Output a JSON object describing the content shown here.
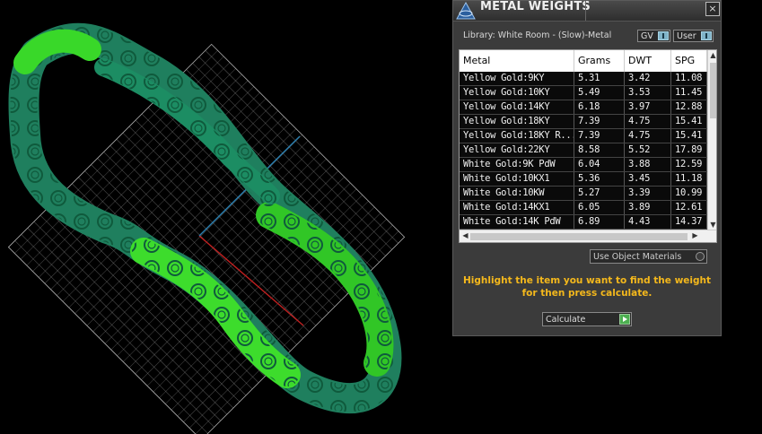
{
  "panel": {
    "title": "METAL WEIGHTS",
    "close_label": "×",
    "library_label": "Library: White Room - (Slow)-Metal",
    "toggle_gv": "GV",
    "toggle_user": "User",
    "use_object_materials": "Use Object Materials",
    "hint_line1": "Highlight the item you want to find the weight",
    "hint_line2": "for then press calculate.",
    "calculate_label": "Calculate"
  },
  "table": {
    "columns": [
      "Metal",
      "Grams",
      "DWT",
      "SPG"
    ],
    "rows": [
      [
        "Yellow Gold:9KY",
        "5.31",
        "3.42",
        "11.08"
      ],
      [
        "Yellow Gold:10KY",
        "5.49",
        "3.53",
        "11.45"
      ],
      [
        "Yellow Gold:14KY",
        "6.18",
        "3.97",
        "12.88"
      ],
      [
        "Yellow Gold:18KY",
        "7.39",
        "4.75",
        "15.41"
      ],
      [
        "Yellow Gold:18KY R...",
        "7.39",
        "4.75",
        "15.41"
      ],
      [
        "Yellow Gold:22KY",
        "8.58",
        "5.52",
        "17.89"
      ],
      [
        "White Gold:9K PdW",
        "6.04",
        "3.88",
        "12.59"
      ],
      [
        "White Gold:10KX1",
        "5.36",
        "3.45",
        "11.18"
      ],
      [
        "White Gold:10KW",
        "5.27",
        "3.39",
        "10.99"
      ],
      [
        "White Gold:14KX1",
        "6.05",
        "3.89",
        "12.61"
      ],
      [
        "White Gold:14K PdW",
        "6.89",
        "4.43",
        "14.37"
      ]
    ]
  },
  "colors": {
    "hint": "#f4b81c",
    "ring_bright": "#3ddc2c",
    "ring_dark": "#1f8a6a",
    "grid": "#bdbdbd"
  },
  "icons": {
    "app": "matrix-app-icon",
    "close": "close-icon",
    "scroll_up": "arrow-up-icon",
    "scroll_down": "arrow-down-icon",
    "scroll_left": "arrow-left-icon",
    "scroll_right": "arrow-right-icon",
    "calculate": "play-icon"
  }
}
